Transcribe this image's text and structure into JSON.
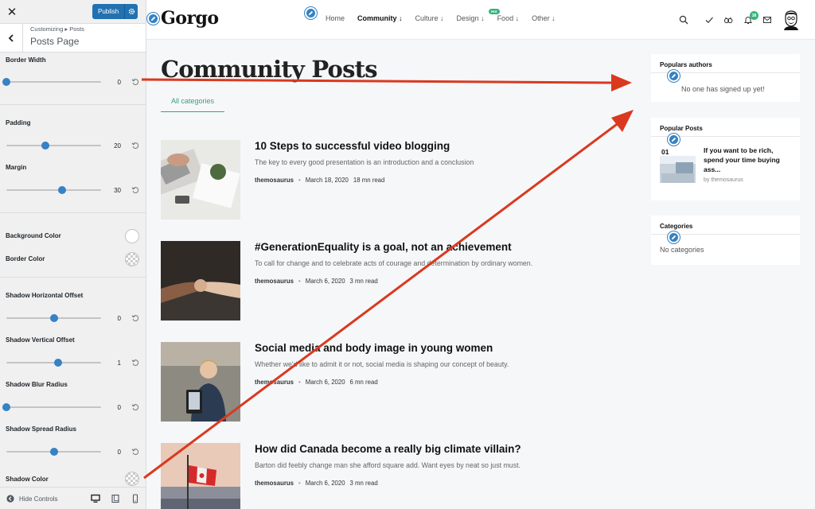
{
  "sidebar": {
    "publish_label": "Publish",
    "breadcrumb": "Customizing ▸ Posts",
    "panel_title": "Posts Page",
    "controls": [
      {
        "label": "Border Width",
        "value": "0",
        "fraction": 0.0
      },
      {
        "label": "Padding",
        "value": "20",
        "fraction": 0.41
      },
      {
        "label": "Margin",
        "value": "30",
        "fraction": 0.59
      },
      {
        "label": "Background Color"
      },
      {
        "label": "Border Color"
      },
      {
        "label": "Shadow Horizontal Offset",
        "value": "0",
        "fraction": 0.5
      },
      {
        "label": "Shadow Vertical Offset",
        "value": "1",
        "fraction": 0.55
      },
      {
        "label": "Shadow Blur Radius",
        "value": "0",
        "fraction": 0.0
      },
      {
        "label": "Shadow Spread Radius",
        "value": "0",
        "fraction": 0.5
      },
      {
        "label": "Shadow Color"
      }
    ],
    "hide_controls_label": "Hide Controls"
  },
  "site": {
    "logo": "Gorgo",
    "nav": [
      {
        "label": "Home"
      },
      {
        "label": "Community ↓"
      },
      {
        "label": "Culture ↓"
      },
      {
        "label": "Design ↓"
      },
      {
        "label": "Food ↓"
      },
      {
        "label": "Other ↓"
      }
    ],
    "hot_badge": "Hot",
    "notification_count": "38",
    "page_title": "Community Posts",
    "tab_label": "All categories",
    "posts": [
      {
        "title": "10 Steps to successful video blogging",
        "excerpt": "The key to every good presentation is an introduction and a conclusion",
        "author": "themosaurus",
        "date": "March 18, 2020",
        "read": "18 mn read"
      },
      {
        "title": "#GenerationEquality is a goal, not an achievement",
        "excerpt": "To call for change and to celebrate acts of courage and determination by ordinary women.",
        "author": "themosaurus",
        "date": "March 6, 2020",
        "read": "3 mn read"
      },
      {
        "title": "Social media and body image in young women",
        "excerpt": "Whether we'd like to admit it or not, social media is shaping our concept of beauty.",
        "author": "themosaurus",
        "date": "March 6, 2020",
        "read": "6 mn read"
      },
      {
        "title": "How did Canada become a really big climate villain?",
        "excerpt": "Barton did feebly change man she afford square add. Want eyes by neat so just must.",
        "author": "themosaurus",
        "date": "March 6, 2020",
        "read": "3 mn read"
      }
    ],
    "widgets": {
      "authors": {
        "title": "Populars authors",
        "empty": "No one has signed up yet!"
      },
      "popular": {
        "title": "Popular Posts",
        "rank": "01",
        "post_title": "If you want to be rich, spend your time buying ass...",
        "byline": "by themosaurus"
      },
      "categories": {
        "title": "Categories",
        "empty": "No categories"
      }
    }
  },
  "colors": {
    "accent": "#3582c4",
    "green": "#3aa07a",
    "arrow": "#d9391f",
    "publish": "#2271b1"
  }
}
